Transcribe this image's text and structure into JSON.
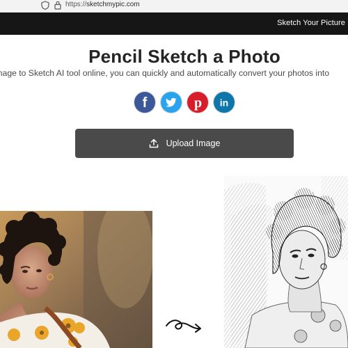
{
  "browser": {
    "url_scheme": "https://",
    "url_host": "sketchmypic.com"
  },
  "nav": {
    "link": "Sketch Your Picture"
  },
  "hero": {
    "title": "Pencil Sketch a Photo",
    "subtitle": "Image to Sketch AI tool online, you can quickly and automatically convert your photos into"
  },
  "share": {
    "buttons": [
      {
        "network": "facebook",
        "color": "#3b5998",
        "glyph": "f"
      },
      {
        "network": "twitter",
        "color": "#1da1f2",
        "glyph": "t"
      },
      {
        "network": "pinterest",
        "color": "#e60023",
        "glyph": "P"
      },
      {
        "network": "linkedin",
        "color": "#0a66c2",
        "glyph": "in"
      }
    ]
  },
  "upload": {
    "label": "Upload Image"
  }
}
